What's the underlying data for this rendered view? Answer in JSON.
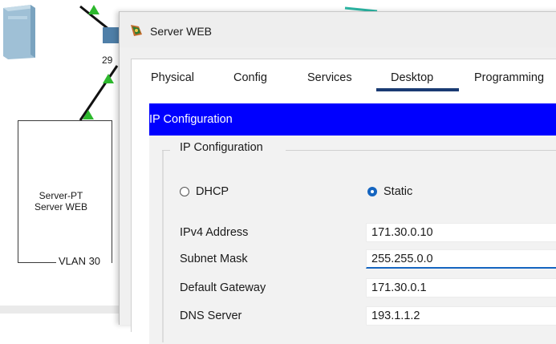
{
  "topology": {
    "switch_label": "29",
    "server_label_line1": "Server-PT",
    "server_label_line2": "Server WEB",
    "vlan_label": "VLAN 30"
  },
  "window": {
    "title": "Server WEB",
    "title_icon": "packet-tracer-icon",
    "tabs": [
      {
        "label": "Physical",
        "active": false
      },
      {
        "label": "Config",
        "active": false
      },
      {
        "label": "Services",
        "active": false
      },
      {
        "label": "Desktop",
        "active": true
      },
      {
        "label": "Programming",
        "active": false
      }
    ]
  },
  "ip_config": {
    "header": "IP Configuration",
    "group_title": "IP Configuration",
    "mode_options": [
      {
        "label": "DHCP",
        "selected": false
      },
      {
        "label": "Static",
        "selected": true
      }
    ],
    "fields": [
      {
        "label": "IPv4 Address",
        "value": "171.30.0.10"
      },
      {
        "label": "Subnet Mask",
        "value": "255.255.0.0"
      },
      {
        "label": "Default Gateway",
        "value": "171.30.0.1"
      },
      {
        "label": "DNS Server",
        "value": "193.1.1.2"
      }
    ]
  },
  "colors": {
    "header_bg": "#0000ff",
    "accent": "#1565c0",
    "tab_underline": "#1a3b73",
    "link_green": "#2db82d"
  }
}
